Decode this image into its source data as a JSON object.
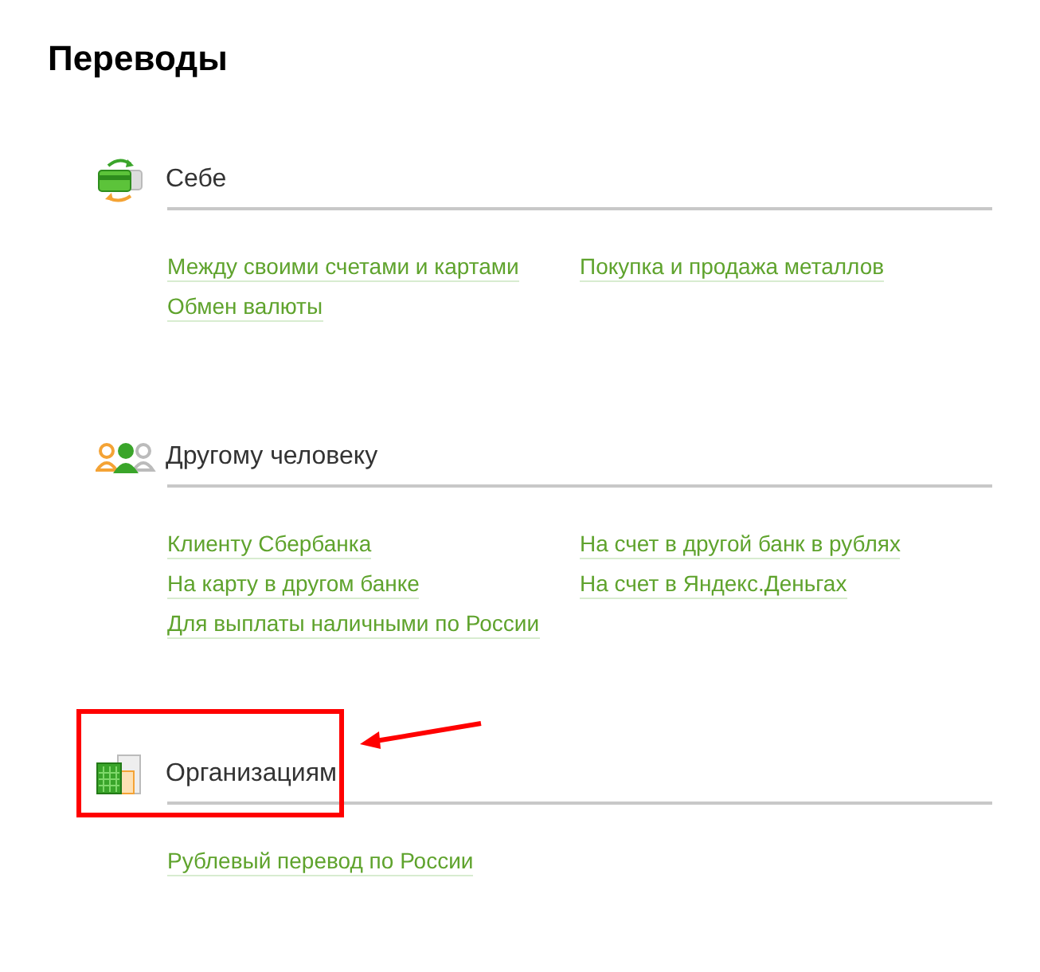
{
  "title": "Переводы",
  "sections": [
    {
      "kind": "self",
      "heading": "Себе",
      "highlighted": false,
      "columns": [
        [
          "Между своими счетами и картами",
          "Обмен валюты"
        ],
        [
          "Покупка и продажа металлов"
        ]
      ]
    },
    {
      "kind": "person",
      "heading": "Другому человеку",
      "highlighted": false,
      "columns": [
        [
          "Клиенту Сбербанка",
          "На карту в другом банке",
          "Для выплаты наличными по России"
        ],
        [
          "На счет в другой банк в рублях",
          "На счет в Яндекс.Деньгах"
        ]
      ]
    },
    {
      "kind": "organization",
      "heading": "Организациям",
      "highlighted": true,
      "columns": [
        [
          "Рублевый перевод по России"
        ]
      ]
    }
  ]
}
